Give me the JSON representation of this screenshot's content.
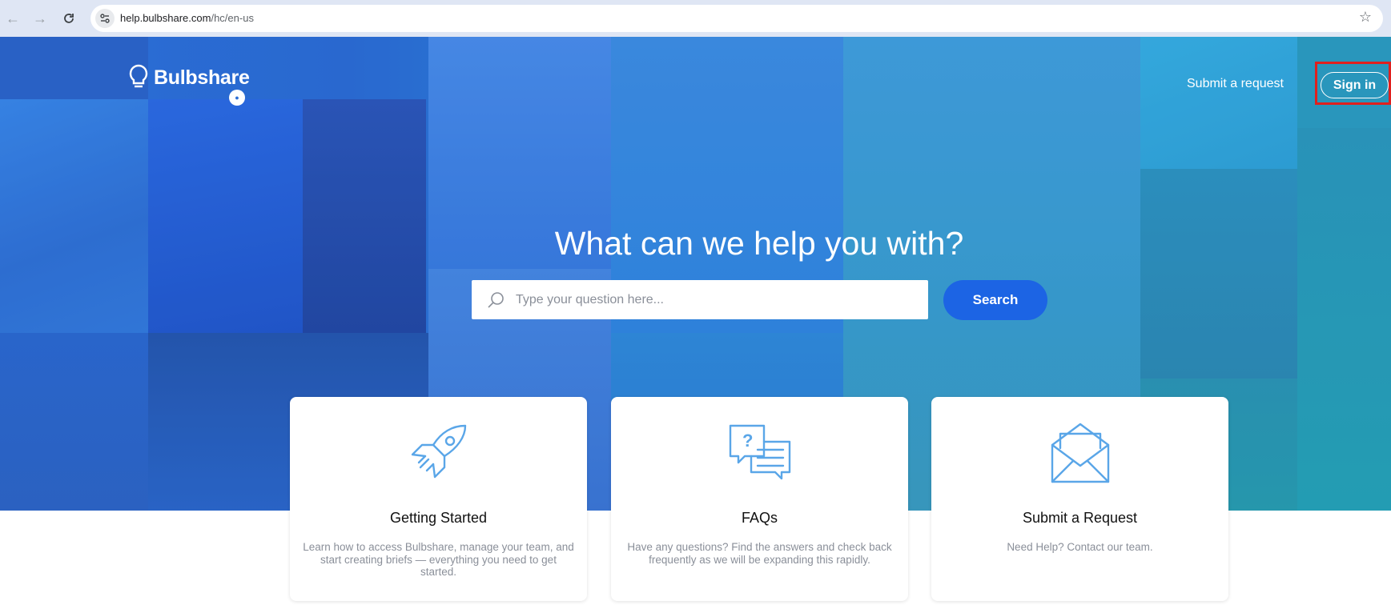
{
  "browser": {
    "url_host": "help.bulbshare.com",
    "url_path": "/hc/en-us"
  },
  "header": {
    "logo_text": "Bulbshare",
    "submit_request_link": "Submit a request",
    "sign_in_button": "Sign in"
  },
  "hero": {
    "headline": "What can we help you with?",
    "search_placeholder": "Type your question here...",
    "search_button": "Search"
  },
  "cards": [
    {
      "icon": "rocket-icon",
      "title": "Getting Started",
      "description": "Learn how to access Bulbshare, manage your team, and start creating briefs — everything you need to get started."
    },
    {
      "icon": "faq-chat-icon",
      "title": "FAQs",
      "description": "Have any questions? Find the answers and check back frequently as we will be expanding this rapidly."
    },
    {
      "icon": "envelope-icon",
      "title": "Submit a Request",
      "description": "Need Help? Contact our team."
    }
  ],
  "colors": {
    "accent": "#1c64e4",
    "icon_blue": "#5aa6e8",
    "highlight_red": "#e0201e"
  }
}
